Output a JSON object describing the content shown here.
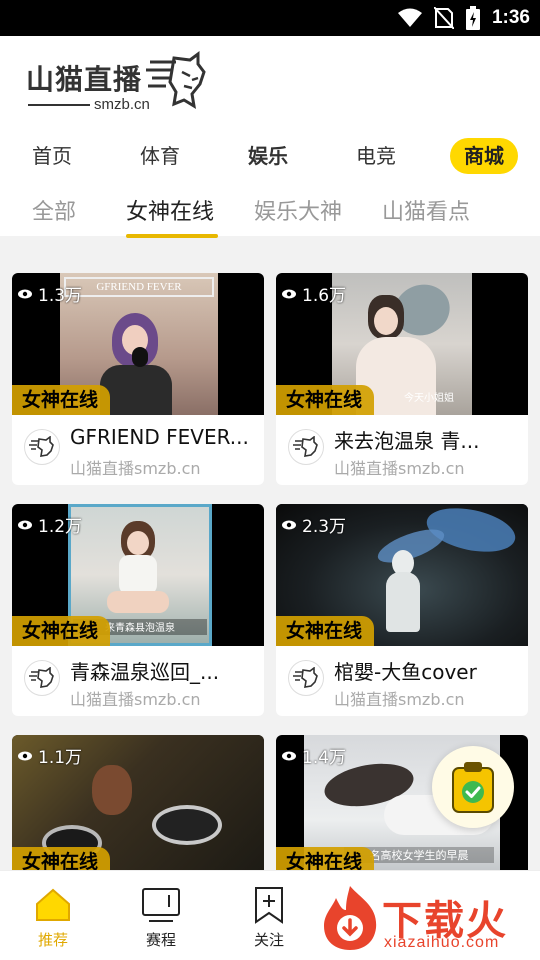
{
  "status_bar": {
    "time": "1:36"
  },
  "logo": {
    "name": "山猫直播",
    "domain": "smzb.cn"
  },
  "main_tabs": [
    {
      "label": "首页"
    },
    {
      "label": "体育"
    },
    {
      "label": "娱乐"
    },
    {
      "label": "电竞"
    },
    {
      "label": "商城"
    }
  ],
  "sub_tabs": [
    {
      "label": "全部"
    },
    {
      "label": "女神在线"
    },
    {
      "label": "娱乐大神"
    },
    {
      "label": "山猫看点"
    }
  ],
  "cards": [
    {
      "views": "1.3万",
      "badge": "女神在线",
      "title": "GFRIEND FEVER...",
      "subtitle": "山猫直播smzb.cn",
      "thumb_caption": "GFRIEND FEVER"
    },
    {
      "views": "1.6万",
      "badge": "女神在线",
      "title": "来去泡温泉 青...",
      "subtitle": "山猫直播smzb.cn",
      "thumb_caption": "今天小姐姐"
    },
    {
      "views": "1.2万",
      "badge": "女神在线",
      "title": "青森温泉巡回_...",
      "subtitle": "山猫直播smzb.cn",
      "thumb_caption": "来青森县泡温泉"
    },
    {
      "views": "2.3万",
      "badge": "女神在线",
      "title": "棺嬰-大鱼cover",
      "subtitle": "山猫直播smzb.cn",
      "thumb_caption": ""
    },
    {
      "views": "1.1万",
      "badge": "女神在线",
      "title": "",
      "subtitle": "",
      "thumb_caption": ""
    },
    {
      "views": "1.4万",
      "badge": "女神在线",
      "title": "",
      "subtitle": "",
      "thumb_caption": "名高校女学生的早晨"
    }
  ],
  "bottom_nav": [
    {
      "label": "推荐",
      "icon": "home-icon",
      "active": true
    },
    {
      "label": "赛程",
      "icon": "schedule-icon",
      "active": false
    },
    {
      "label": "关注",
      "icon": "bookmark-icon",
      "active": false
    }
  ],
  "watermark": {
    "text": "下载火",
    "url": "xiazaihuo.com"
  },
  "colors": {
    "accent": "#ffd800",
    "badge": "#d2a000",
    "watermark": "#e8442c",
    "active_nav": "#e0a800"
  }
}
